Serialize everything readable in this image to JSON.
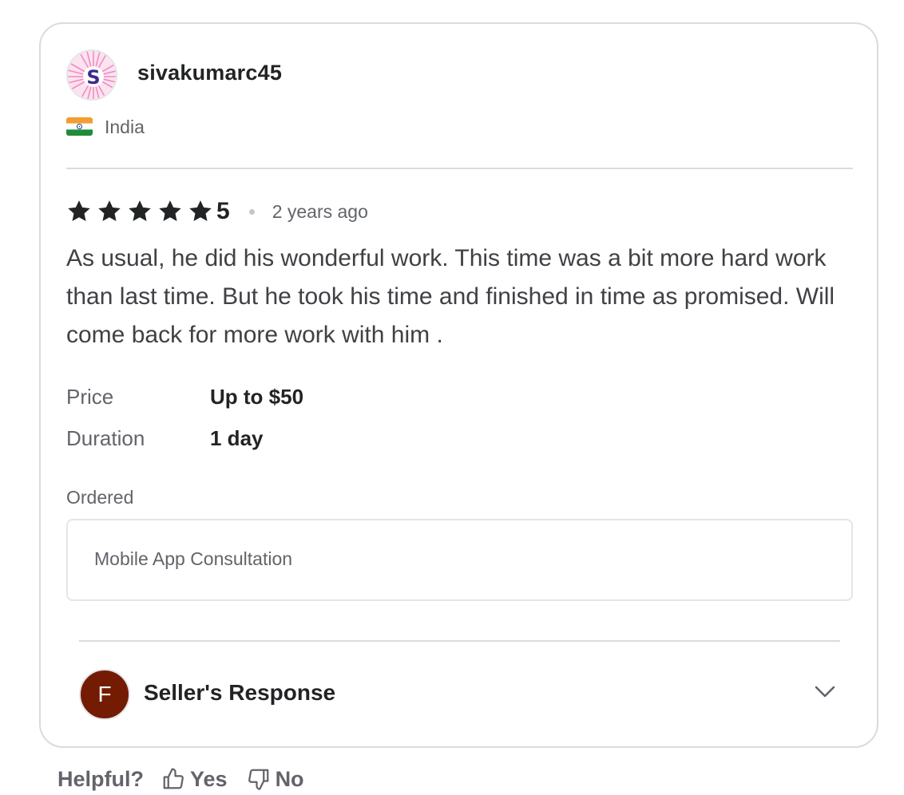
{
  "reviewer": {
    "username": "sivakumarc45",
    "avatar_letter": "S",
    "country": "India",
    "country_flag_icon": "india-flag-icon"
  },
  "review": {
    "rating": 5,
    "rating_label": "5",
    "stars_filled": 5,
    "time_ago": "2 years ago",
    "text": "As usual, he did his wonderful work. This time was a bit more hard work than last time. But he took his time and finished in time as promised. Will come back for more work with him ."
  },
  "details": {
    "price_label": "Price",
    "price_value": "Up to $50",
    "duration_label": "Duration",
    "duration_value": "1 day"
  },
  "ordered": {
    "label": "Ordered",
    "item": "Mobile App Consultation"
  },
  "seller_response": {
    "avatar_letter": "F",
    "title": "Seller's Response",
    "expand_icon": "chevron-down-icon"
  },
  "helpful": {
    "label": "Helpful?",
    "yes_label": "Yes",
    "no_label": "No"
  },
  "colors": {
    "text_primary": "#222325",
    "text_secondary": "#62646a",
    "border": "#dadbdd",
    "seller_avatar_bg": "#741b04",
    "star": "#222325"
  }
}
